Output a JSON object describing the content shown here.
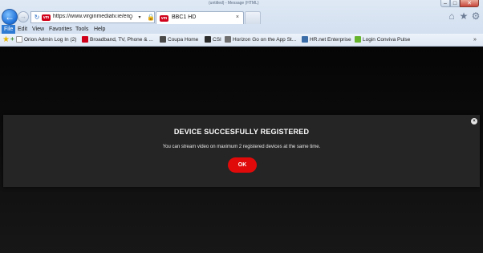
{
  "window": {
    "title": "(untitled) - Message (HTML)",
    "minimize": "–",
    "maximize": "□",
    "close": "✕"
  },
  "nav": {
    "back_icon": "←",
    "forward_icon": "→"
  },
  "address_bar": {
    "url": "https://www.virginmediatv.ie/en",
    "refresh_icon": "↻",
    "favicon": "vm",
    "search_icon": "⚲",
    "dropdown_icon": "▾",
    "lock_icon": "🔒"
  },
  "tabs": [
    {
      "label": "BBC1 HD",
      "favicon": "vm",
      "close": "×"
    }
  ],
  "toolbar_icons": {
    "home": "⌂",
    "favorites": "★",
    "settings": "⚙"
  },
  "menu": [
    "File",
    "Edit",
    "View",
    "Favorites",
    "Tools",
    "Help"
  ],
  "favorites_bar": {
    "items": [
      {
        "label": "Orion Admin Log In (2)",
        "color": "#ffffff"
      },
      {
        "label": "Broadband, TV, Phone & ...",
        "color": "#d0021b"
      },
      {
        "label": "Coupa Home",
        "color": "#4a4a4a"
      },
      {
        "label": "CSI",
        "color": "#2b2b2b"
      },
      {
        "label": "Horizon Go on the App St...",
        "color": "#6f6f6f"
      },
      {
        "label": "HR.net Enterprise",
        "color": "#3b6ea8"
      },
      {
        "label": "Login Conviva Pulse",
        "color": "#66b32e"
      }
    ],
    "more": "»"
  },
  "modal": {
    "title": "DEVICE SUCCESFULLY REGISTERED",
    "message": "You can stream video on maximum 2 registered devices at the same time.",
    "ok_label": "OK",
    "close": "×"
  },
  "colors": {
    "accent": "#e10a0a",
    "modal_bg": "#252525",
    "page_bg": "#0a0a0a"
  }
}
